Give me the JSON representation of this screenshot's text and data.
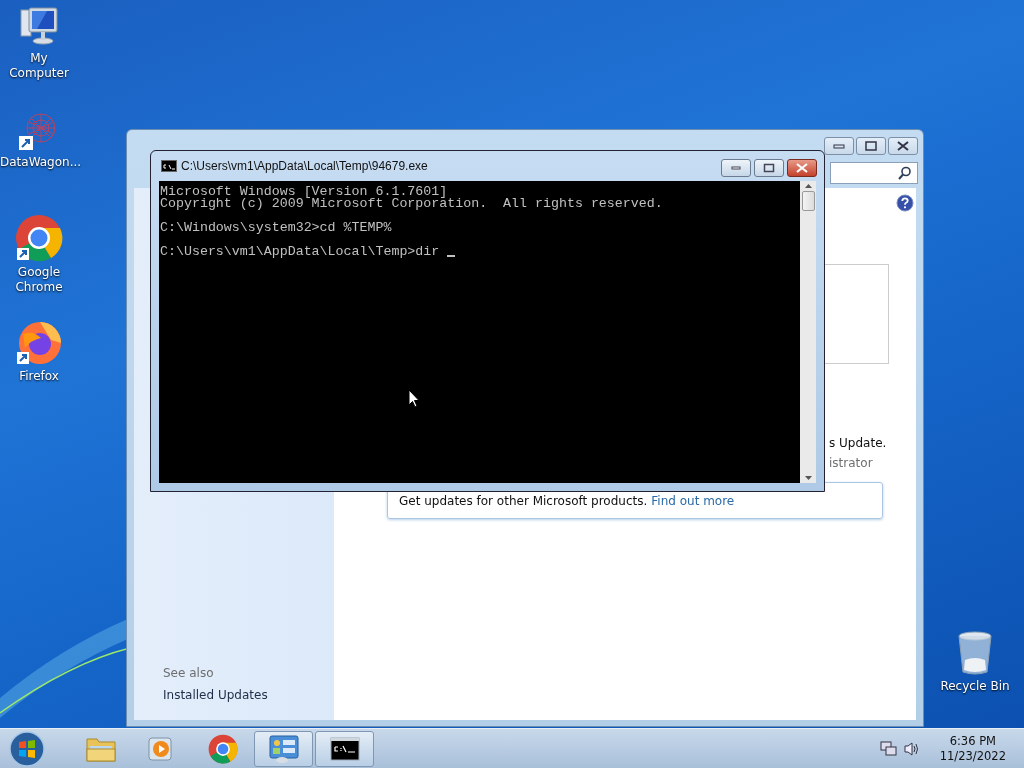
{
  "desktop_icons": [
    {
      "kind": "computer",
      "label": "My Computer"
    },
    {
      "kind": "network",
      "label": "DataWagon..."
    },
    {
      "kind": "chrome",
      "label": "Google Chrome"
    },
    {
      "kind": "firefox",
      "label": "Firefox"
    }
  ],
  "desktop_icons_right": [
    {
      "kind": "recycle",
      "label": "Recycle Bin"
    }
  ],
  "update_window": {
    "content_lines": [
      {
        "kind": "main",
        "text": "s Update."
      },
      {
        "kind": "muted",
        "text": "istrator"
      }
    ],
    "info_bar": {
      "text": "Get updates for other Microsoft products.",
      "link": "Find out more"
    },
    "see_also": {
      "heading": "See also",
      "links": [
        "Installed Updates"
      ]
    }
  },
  "console_window": {
    "title": "C:\\Users\\vm1\\AppData\\Local\\Temp\\94679.exe",
    "blocks": [
      [
        "Microsoft Windows [Version 6.1.7601]",
        "Copyright (c) 2009 Microsoft Corporation.  All rights reserved."
      ],
      [
        "C:\\Windows\\system32>cd %TEMP%"
      ],
      [
        "C:\\Users\\vm1\\AppData\\Local\\Temp>dir "
      ]
    ]
  },
  "taskbar": {
    "items": [
      {
        "kind": "explorer",
        "running": false
      },
      {
        "kind": "media",
        "running": false
      },
      {
        "kind": "chrome",
        "running": false
      },
      {
        "kind": "control",
        "running": true
      },
      {
        "kind": "console",
        "running": true
      }
    ],
    "clock": {
      "time": "6:36 PM",
      "date": "11/23/2022"
    }
  }
}
